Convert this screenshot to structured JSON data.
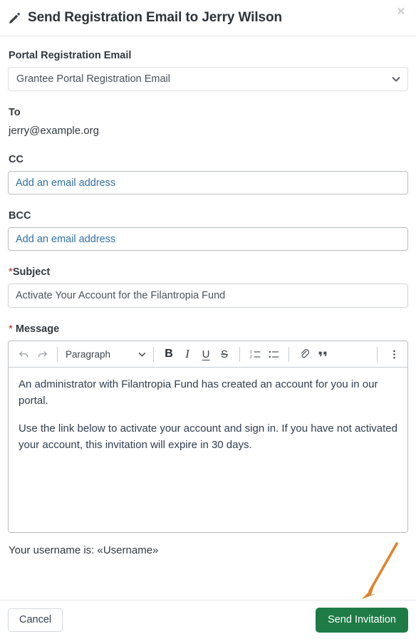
{
  "header": {
    "icon": "pencil-icon",
    "title": "Send Registration Email to Jerry Wilson",
    "close_label": "×"
  },
  "form": {
    "portal_email": {
      "label": "Portal Registration Email",
      "selected": "Grantee Portal Registration Email",
      "options": [
        "Grantee Portal Registration Email"
      ],
      "chevron": "chevron-down-icon"
    },
    "to": {
      "label": "To",
      "value": "jerry@example.org"
    },
    "cc": {
      "label": "CC",
      "value": "",
      "placeholder": "Add an email address"
    },
    "bcc": {
      "label": "BCC",
      "value": "",
      "placeholder": "Add an email address"
    },
    "subject": {
      "required_marker": "*",
      "label": "Subject",
      "value": "Activate Your Account for the Filantropia Fund",
      "placeholder": ""
    },
    "message": {
      "required_marker": "*",
      "label": " Message",
      "paragraphs": [
        "An administrator with Filantropia Fund has created an account for you in our portal.",
        "Use the link below to activate your account and sign in. If you have not activated your account, this invitation will expire in 30 days."
      ]
    }
  },
  "editor_toolbar": {
    "undo": "undo-icon",
    "redo": "redo-icon",
    "block_format": "Paragraph",
    "bold": "B",
    "italic": "I",
    "underline": "U",
    "strikethrough": "S",
    "numbered_list": "numbered-list-icon",
    "bulleted_list": "bulleted-list-icon",
    "link": "link-icon",
    "blockquote": "““",
    "more": "more-options-icon"
  },
  "username_note": "Your username is: «Username»",
  "footer": {
    "cancel_label": "Cancel",
    "send_label": "Send Invitation"
  },
  "annotation": {
    "type": "arrow",
    "color": "#e08game",
    "points_to": "Send Invitation"
  },
  "colors": {
    "primary_green": "#1e7b46",
    "required_red": "#b02a24",
    "placeholder_blue": "#2f6fa4",
    "annotation_orange": "#e0822b",
    "body_text": "#313d4f"
  }
}
